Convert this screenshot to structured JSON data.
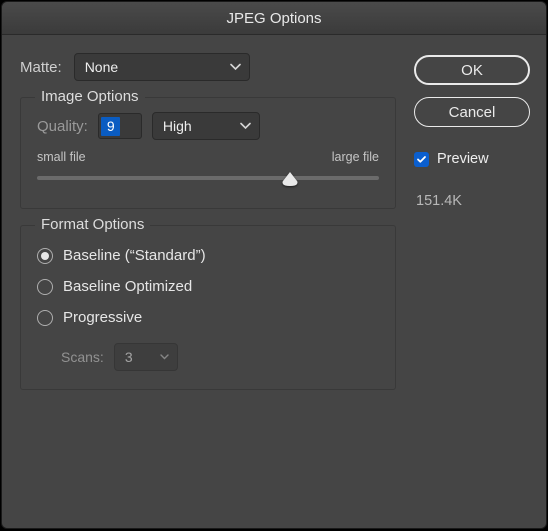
{
  "title": "JPEG Options",
  "matte": {
    "label": "Matte:",
    "value": "None"
  },
  "image_options": {
    "legend": "Image Options",
    "quality_label": "Quality:",
    "quality_value": "9",
    "quality_preset": "High",
    "slider": {
      "left": "small file",
      "right": "large file",
      "percent": 74
    }
  },
  "format_options": {
    "legend": "Format Options",
    "options": [
      {
        "label": "Baseline (“Standard”)",
        "selected": true
      },
      {
        "label": "Baseline Optimized",
        "selected": false
      },
      {
        "label": "Progressive",
        "selected": false
      }
    ],
    "scans": {
      "label": "Scans:",
      "value": "3"
    }
  },
  "buttons": {
    "ok": "OK",
    "cancel": "Cancel"
  },
  "preview": {
    "label": "Preview",
    "checked": true
  },
  "filesize": "151.4K"
}
